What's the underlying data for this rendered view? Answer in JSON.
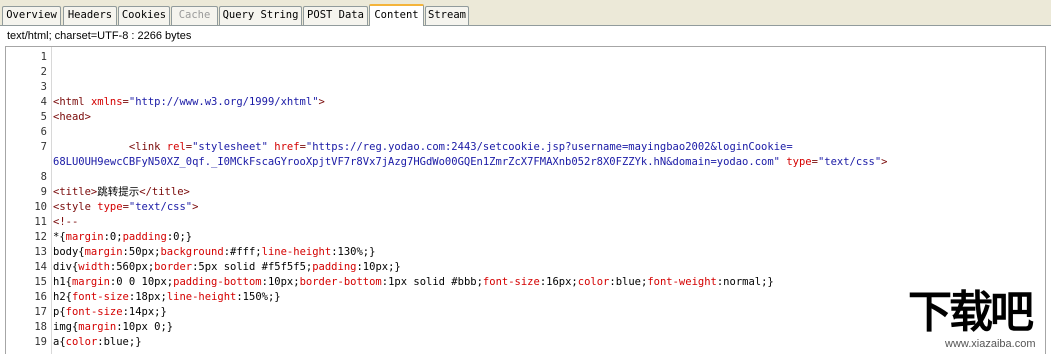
{
  "tabs": [
    {
      "label": "Overview",
      "state": "normal"
    },
    {
      "label": "Headers",
      "state": "normal"
    },
    {
      "label": "Cookies",
      "state": "normal"
    },
    {
      "label": "Cache",
      "state": "disabled"
    },
    {
      "label": "Query String",
      "state": "normal"
    },
    {
      "label": "POST Data",
      "state": "normal"
    },
    {
      "label": "Content",
      "state": "active"
    },
    {
      "label": "Stream",
      "state": "normal"
    }
  ],
  "content_type": "text/html; charset=UTF-8 : 2266 bytes",
  "lines": [
    {
      "n": "1",
      "parts": []
    },
    {
      "n": "2",
      "parts": []
    },
    {
      "n": "3",
      "parts": []
    },
    {
      "n": "4",
      "parts": [
        [
          "t",
          "<html "
        ],
        [
          "a",
          "xmlns"
        ],
        [
          "t",
          "="
        ],
        [
          "v",
          "\"http://www.w3.org/1999/xhtml\""
        ],
        [
          "t",
          ">"
        ]
      ]
    },
    {
      "n": "5",
      "parts": [
        [
          "t",
          "<head>"
        ]
      ]
    },
    {
      "n": "6",
      "parts": []
    },
    {
      "n": "7",
      "parts": [
        [
          "p",
          "            "
        ],
        [
          "t",
          "<link "
        ],
        [
          "a",
          "rel"
        ],
        [
          "t",
          "="
        ],
        [
          "v",
          "\"stylesheet\""
        ],
        [
          "p",
          " "
        ],
        [
          "a",
          "href"
        ],
        [
          "t",
          "="
        ],
        [
          "v",
          "\"https://reg.yodao.com:2443/setcookie.jsp?username=mayingbao2002&loginCookie="
        ]
      ]
    },
    {
      "n": "",
      "parts": [
        [
          "v",
          "68LU0UH9ewcCBFyN50XZ_0qf._I0MCkFscaGYrooXpjtVF7r8Vx7jAzg7HGdWo00GQEn1ZmrZcX7FMAXnb052r8X0FZZYk.hN&domain=yodao.com\""
        ],
        [
          "p",
          " "
        ],
        [
          "a",
          "type"
        ],
        [
          "t",
          "="
        ],
        [
          "v",
          "\"text/css\""
        ],
        [
          "t",
          ">"
        ]
      ]
    },
    {
      "n": "8",
      "parts": []
    },
    {
      "n": "9",
      "parts": [
        [
          "t",
          "<title>"
        ],
        [
          "p",
          "跳转提示"
        ],
        [
          "t",
          "</title>"
        ]
      ]
    },
    {
      "n": "10",
      "parts": [
        [
          "t",
          "<style "
        ],
        [
          "a",
          "type"
        ],
        [
          "t",
          "="
        ],
        [
          "v",
          "\"text/css\""
        ],
        [
          "t",
          ">"
        ]
      ]
    },
    {
      "n": "11",
      "parts": [
        [
          "t",
          "<!--"
        ]
      ]
    },
    {
      "n": "12",
      "parts": [
        [
          "p",
          "*{"
        ],
        [
          "a",
          "margin"
        ],
        [
          "p",
          ":0;"
        ],
        [
          "a",
          "padding"
        ],
        [
          "p",
          ":0;}"
        ]
      ]
    },
    {
      "n": "13",
      "parts": [
        [
          "p",
          "body{"
        ],
        [
          "a",
          "margin"
        ],
        [
          "p",
          ":50px;"
        ],
        [
          "a",
          "background"
        ],
        [
          "p",
          ":#fff;"
        ],
        [
          "a",
          "line-height"
        ],
        [
          "p",
          ":130%;}"
        ]
      ]
    },
    {
      "n": "14",
      "parts": [
        [
          "p",
          "div{"
        ],
        [
          "a",
          "width"
        ],
        [
          "p",
          ":560px;"
        ],
        [
          "a",
          "border"
        ],
        [
          "p",
          ":5px solid #f5f5f5;"
        ],
        [
          "a",
          "padding"
        ],
        [
          "p",
          ":10px;}"
        ]
      ]
    },
    {
      "n": "15",
      "parts": [
        [
          "p",
          "h1{"
        ],
        [
          "a",
          "margin"
        ],
        [
          "p",
          ":0 0 10px;"
        ],
        [
          "a",
          "padding-bottom"
        ],
        [
          "p",
          ":10px;"
        ],
        [
          "a",
          "border-bottom"
        ],
        [
          "p",
          ":1px solid #bbb;"
        ],
        [
          "a",
          "font-size"
        ],
        [
          "p",
          ":16px;"
        ],
        [
          "a",
          "color"
        ],
        [
          "p",
          ":blue;"
        ],
        [
          "a",
          "font-weight"
        ],
        [
          "p",
          ":normal;}"
        ]
      ]
    },
    {
      "n": "16",
      "parts": [
        [
          "p",
          "h2{"
        ],
        [
          "a",
          "font-size"
        ],
        [
          "p",
          ":18px;"
        ],
        [
          "a",
          "line-height"
        ],
        [
          "p",
          ":150%;}"
        ]
      ]
    },
    {
      "n": "17",
      "parts": [
        [
          "p",
          "p{"
        ],
        [
          "a",
          "font-size"
        ],
        [
          "p",
          ":14px;}"
        ]
      ]
    },
    {
      "n": "18",
      "parts": [
        [
          "p",
          "img{"
        ],
        [
          "a",
          "margin"
        ],
        [
          "p",
          ":10px 0;}"
        ]
      ]
    },
    {
      "n": "19",
      "parts": [
        [
          "p",
          "a{"
        ],
        [
          "a",
          "color"
        ],
        [
          "p",
          ":blue;}"
        ]
      ]
    }
  ],
  "watermark": {
    "big": "下载吧",
    "url": "www.xiazaiba.com"
  }
}
